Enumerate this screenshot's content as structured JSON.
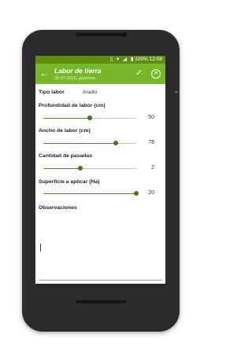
{
  "status_bar": {
    "battery": "100%",
    "time": "12:08"
  },
  "app_bar": {
    "title": "Labor de tierra",
    "subtitle": "20-07-2016, gesolina",
    "back_icon": "arrow-back-icon",
    "confirm_icon": "check-icon",
    "cancel_icon": "close-circle-icon"
  },
  "form": {
    "tipo_labor": {
      "label": "Tipo labor",
      "value": "Arado"
    },
    "profundidad": {
      "label": "Profundidad de labor (cm)",
      "value": "50",
      "fraction": 0.5
    },
    "ancho": {
      "label": "Ancho de labor (cm)",
      "value": "78",
      "fraction": 0.78
    },
    "pasadas": {
      "label": "Cantidad de pasadas",
      "value": "2",
      "fraction": 0.4
    },
    "superficie": {
      "label": "Superficie a aplicar (Ha)",
      "value": "20",
      "fraction": 1.0
    },
    "observaciones": {
      "label": "Observaciones",
      "value": ""
    }
  },
  "colors": {
    "appbar": "#76b82a",
    "statusbar": "#5f8f12",
    "accent": "#3f7a12"
  }
}
